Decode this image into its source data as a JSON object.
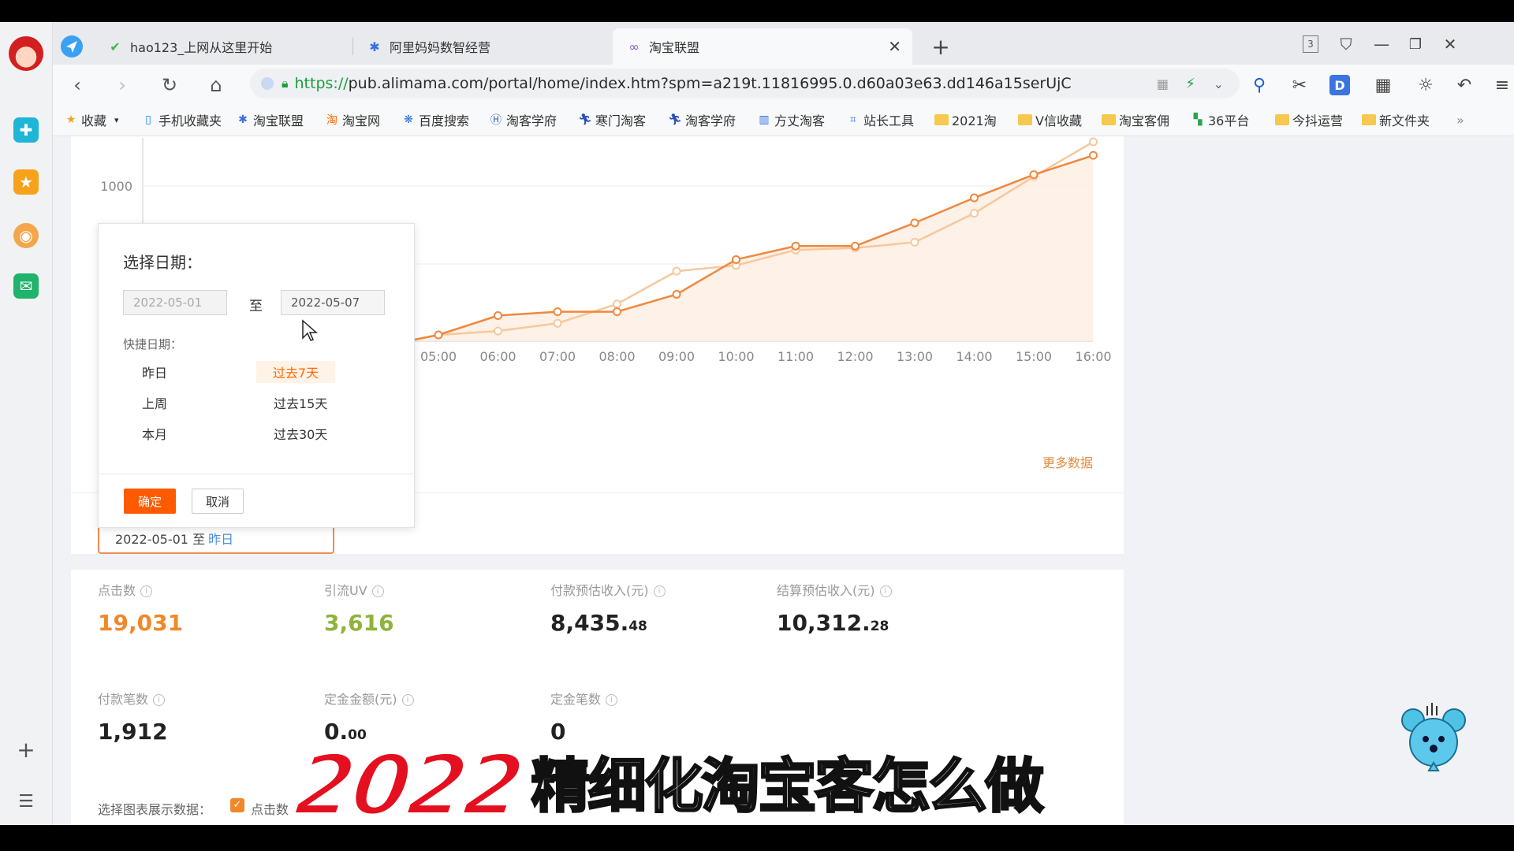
{
  "tabs": [
    {
      "label": "hao123_上网从这里开始",
      "icon": "hao123-icon"
    },
    {
      "label": "阿里妈妈数智经营",
      "icon": "alimama-icon"
    },
    {
      "label": "淘宝联盟",
      "icon": "taobao-union-icon"
    }
  ],
  "tab_count_badge": "3",
  "address": {
    "scheme": "https://",
    "rest": "pub.alimama.com/portal/home/index.htm?spm=a219t.11816995.0.d60a03e63.dd146a15serUjC"
  },
  "bookmarks": [
    "收藏",
    "手机收藏夹",
    "淘宝联盟",
    "淘宝网",
    "百度搜索",
    "淘客学府",
    "寒门淘客",
    "淘客学府",
    "方丈淘客",
    "站长工具",
    "2021淘",
    "V信收藏",
    "淘宝客佣",
    "36平台",
    "今抖运营",
    "新文件夹"
  ],
  "chart_data": {
    "type": "line",
    "x": [
      "05:00",
      "06:00",
      "07:00",
      "08:00",
      "09:00",
      "10:00",
      "11:00",
      "12:00",
      "13:00",
      "14:00",
      "15:00",
      "16:00"
    ],
    "ytick": "1000",
    "series": [
      {
        "color": "#f0883e",
        "values": [
          0,
          0.1,
          0.12,
          0.12,
          0.21,
          0.39,
          0.46,
          0.46,
          0.58,
          0.71,
          0.83,
          0.93
        ]
      },
      {
        "color": "#f7c89c",
        "values": [
          0,
          0.02,
          0.06,
          0.16,
          0.33,
          0.36,
          0.44,
          0.45,
          0.48,
          0.63,
          0.82,
          1.0
        ]
      }
    ]
  },
  "datepicker": {
    "title": "选择日期：",
    "start": "2022-05-01",
    "end": "2022-05-07",
    "to": "至",
    "quick_label": "快捷日期：",
    "options": [
      "昨日",
      "过去7天",
      "上周",
      "过去15天",
      "本月",
      "过去30天"
    ],
    "ok": "确定",
    "cancel": "取消"
  },
  "date_field": {
    "range": "2022-05-01 至",
    "suffix": "昨日"
  },
  "more_data": "更多数据",
  "metrics": [
    {
      "label": "点击数",
      "value": "19,031",
      "decimal": "",
      "color": "#f0882a"
    },
    {
      "label": "引流UV",
      "value": "3,616",
      "decimal": "",
      "color": "#8fb33b"
    },
    {
      "label": "付款预估收入(元)",
      "value": "8,435.",
      "decimal": "48",
      "color": "#222222"
    },
    {
      "label": "结算预估收入(元)",
      "value": "10,312.",
      "decimal": "28",
      "color": "#222222"
    },
    {
      "label": "付款笔数",
      "value": "1,912",
      "decimal": "",
      "color": "#222222"
    },
    {
      "label": "定金金额(元)",
      "value": "0.",
      "decimal": "00",
      "color": "#222222"
    },
    {
      "label": "定金笔数",
      "value": "0",
      "decimal": "",
      "color": "#222222"
    }
  ],
  "chart_select": {
    "label": "选择图表展示数据：",
    "first": "点击数"
  },
  "caption": {
    "year": "2022",
    "rest": "精细化淘宝客怎么做"
  }
}
